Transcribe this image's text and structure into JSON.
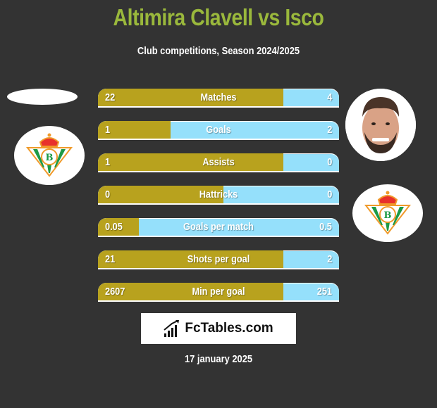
{
  "header": {
    "title": "Altimira Clavell vs Isco",
    "subtitle": "Club competitions, Season 2024/2025"
  },
  "players": {
    "left": {
      "name": "Altimira Clavell",
      "club_badge": "real-betis-crest-icon"
    },
    "right": {
      "name": "Isco",
      "photo": "player-photo",
      "club_badge": "real-betis-crest-icon"
    }
  },
  "colors": {
    "left_bar": "#b8a21e",
    "right_bar": "#95e0fb",
    "title": "#9ab83c",
    "background": "#333333"
  },
  "stats": [
    {
      "label": "Matches",
      "left": "22",
      "right": "4",
      "left_share": 0.77
    },
    {
      "label": "Goals",
      "left": "1",
      "right": "2",
      "left_share": 0.3
    },
    {
      "label": "Assists",
      "left": "1",
      "right": "0",
      "left_share": 0.77
    },
    {
      "label": "Hattricks",
      "left": "0",
      "right": "0",
      "left_share": 0.52
    },
    {
      "label": "Goals per match",
      "left": "0.05",
      "right": "0.5",
      "left_share": 0.17
    },
    {
      "label": "Shots per goal",
      "left": "21",
      "right": "2",
      "left_share": 0.77
    },
    {
      "label": "Min per goal",
      "left": "2607",
      "right": "251",
      "left_share": 0.77
    }
  ],
  "footer": {
    "brand": "FcTables.com",
    "brand_icon": "bar-chart-icon",
    "date": "17 january 2025"
  }
}
